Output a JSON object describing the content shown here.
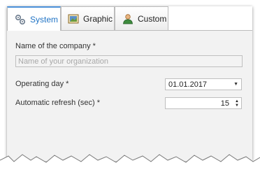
{
  "tabs": [
    {
      "label": "System",
      "icon": "gears-icon",
      "active": true
    },
    {
      "label": "Graphic",
      "icon": "picture-icon",
      "active": false
    },
    {
      "label": "Custom",
      "icon": "user-icon",
      "active": false
    }
  ],
  "form": {
    "company_label": "Name of the company *",
    "company_placeholder": "Name of your organization",
    "operating_day_label": "Operating day *",
    "operating_day_value": "01.01.2017",
    "refresh_label": "Automatic refresh (sec) *",
    "refresh_value": "15"
  },
  "colors": {
    "active_tab_text": "#1f73c5",
    "active_tab_border": "#4a90d9"
  }
}
